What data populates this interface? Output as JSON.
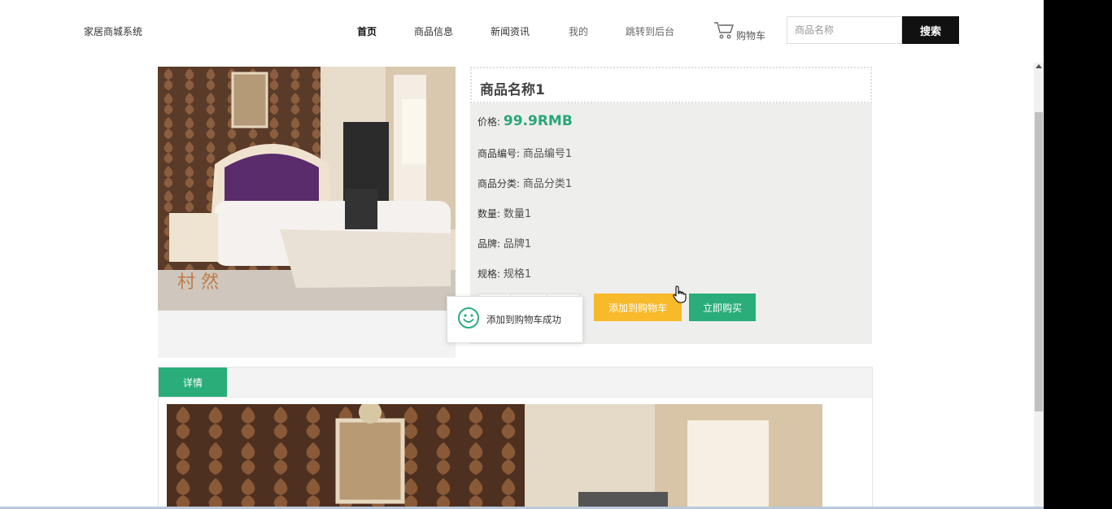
{
  "header": {
    "site_title": "家居商城系统",
    "nav": [
      {
        "label": "首页",
        "active": true
      },
      {
        "label": "商品信息"
      },
      {
        "label": "新闻资讯"
      },
      {
        "label": "我的"
      },
      {
        "label": "跳转到后台"
      }
    ],
    "cart_label": "购物车",
    "search_placeholder": "商品名称",
    "search_button": "搜索"
  },
  "product": {
    "name": "商品名称1",
    "price_label": "价格:",
    "price": "99.9RMB",
    "fields": [
      {
        "label": "商品编号:",
        "value": "商品编号1"
      },
      {
        "label": "商品分类:",
        "value": "商品分类1"
      },
      {
        "label": "数量:",
        "value": "数量1"
      },
      {
        "label": "品牌:",
        "value": "品牌1"
      },
      {
        "label": "规格:",
        "value": "规格1"
      }
    ],
    "add_to_cart_label": "添加到购物车",
    "buy_now_label": "立即购买",
    "image_watermark": "村 然"
  },
  "toast": {
    "message": "添加到购物车成功"
  },
  "details": {
    "tab_label": "详情"
  },
  "colors": {
    "accent_green": "#2aad79",
    "price_green": "#29a777",
    "cart_yellow": "#f8b92a",
    "search_black": "#111111"
  },
  "icons": [
    "cart-icon",
    "smile-icon",
    "hand-cursor-icon",
    "scroll-up-arrow-icon"
  ]
}
